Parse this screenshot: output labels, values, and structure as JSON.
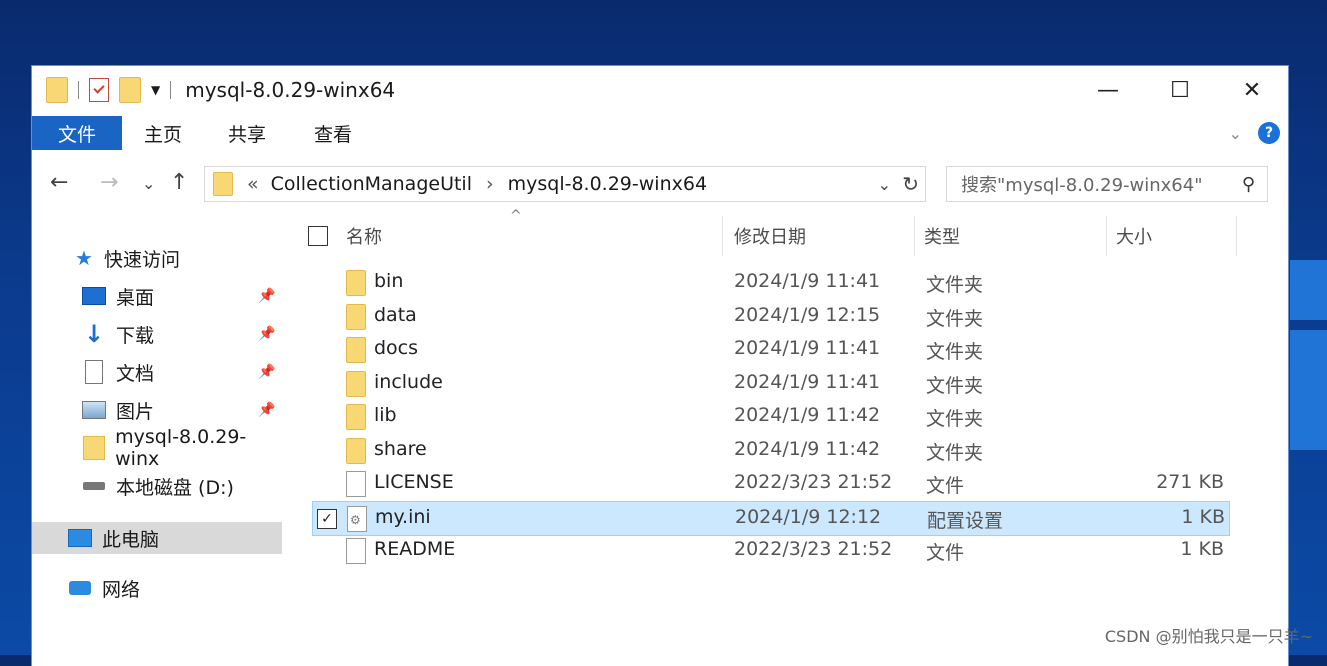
{
  "window": {
    "title": "mysql-8.0.29-winx64",
    "controls": {
      "minimize": "—",
      "maximize": "☐",
      "close": "✕"
    }
  },
  "ribbon": {
    "tabs": [
      "文件",
      "主页",
      "共享",
      "查看"
    ],
    "expand_icon": "chevron-down-icon",
    "help_label": "?"
  },
  "navigation": {
    "back": "←",
    "forward": "→",
    "recent": "⌄",
    "up": "↑",
    "breadcrumb_prefix": "«",
    "breadcrumb": [
      "CollectionManageUtil",
      "mysql-8.0.29-winx64"
    ],
    "breadcrumb_sep": "›",
    "refresh": "↻",
    "search_placeholder": "搜索\"mysql-8.0.29-winx64\""
  },
  "sidebar": {
    "quick_access": "快速访问",
    "items": [
      {
        "label": "桌面",
        "icon": "desktop-icon",
        "pinned": true
      },
      {
        "label": "下载",
        "icon": "download-icon",
        "pinned": true
      },
      {
        "label": "文档",
        "icon": "document-icon",
        "pinned": true
      },
      {
        "label": "图片",
        "icon": "picture-icon",
        "pinned": true
      },
      {
        "label": "mysql-8.0.29-winx",
        "icon": "folder-icon",
        "pinned": false
      },
      {
        "label": "本地磁盘 (D:)",
        "icon": "drive-icon",
        "pinned": false
      }
    ],
    "this_pc": "此电脑",
    "network": "网络"
  },
  "list": {
    "headers": {
      "name": "名称",
      "date": "修改日期",
      "type": "类型",
      "size": "大小"
    },
    "rows": [
      {
        "name": "bin",
        "date": "2024/1/9 11:41",
        "type": "文件夹",
        "size": "",
        "kind": "folder"
      },
      {
        "name": "data",
        "date": "2024/1/9 12:15",
        "type": "文件夹",
        "size": "",
        "kind": "folder"
      },
      {
        "name": "docs",
        "date": "2024/1/9 11:41",
        "type": "文件夹",
        "size": "",
        "kind": "folder"
      },
      {
        "name": "include",
        "date": "2024/1/9 11:41",
        "type": "文件夹",
        "size": "",
        "kind": "folder"
      },
      {
        "name": "lib",
        "date": "2024/1/9 11:42",
        "type": "文件夹",
        "size": "",
        "kind": "folder"
      },
      {
        "name": "share",
        "date": "2024/1/9 11:42",
        "type": "文件夹",
        "size": "",
        "kind": "folder"
      },
      {
        "name": "LICENSE",
        "date": "2022/3/23 21:52",
        "type": "文件",
        "size": "271 KB",
        "kind": "file"
      },
      {
        "name": "my.ini",
        "date": "2024/1/9 12:12",
        "type": "配置设置",
        "size": "1 KB",
        "kind": "config",
        "selected": true
      },
      {
        "name": "README",
        "date": "2022/3/23 21:52",
        "type": "文件",
        "size": "1 KB",
        "kind": "file"
      }
    ]
  },
  "watermark": "CSDN @别怕我只是一只羊~",
  "colors": {
    "accent": "#1a64c4",
    "selection": "#cce8ff",
    "folder": "#f8d775"
  }
}
